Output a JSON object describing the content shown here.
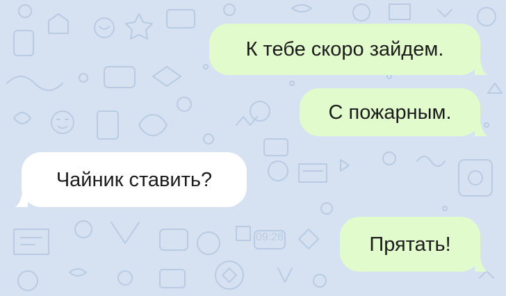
{
  "colors": {
    "wallpaper": "#d6e2f1",
    "doodle": "#b9cbe3",
    "outgoing_bubble": "#e2fbcc",
    "incoming_bubble": "#ffffff",
    "text": "#1b1b1b"
  },
  "wallpaper_clock_text": "09:28",
  "messages": [
    {
      "direction": "outgoing",
      "text": "К тебе скоро зайдем."
    },
    {
      "direction": "outgoing",
      "text": "С пожарным."
    },
    {
      "direction": "incoming",
      "text": "Чайник ставить?"
    },
    {
      "direction": "outgoing",
      "text": "Прятать!"
    }
  ]
}
